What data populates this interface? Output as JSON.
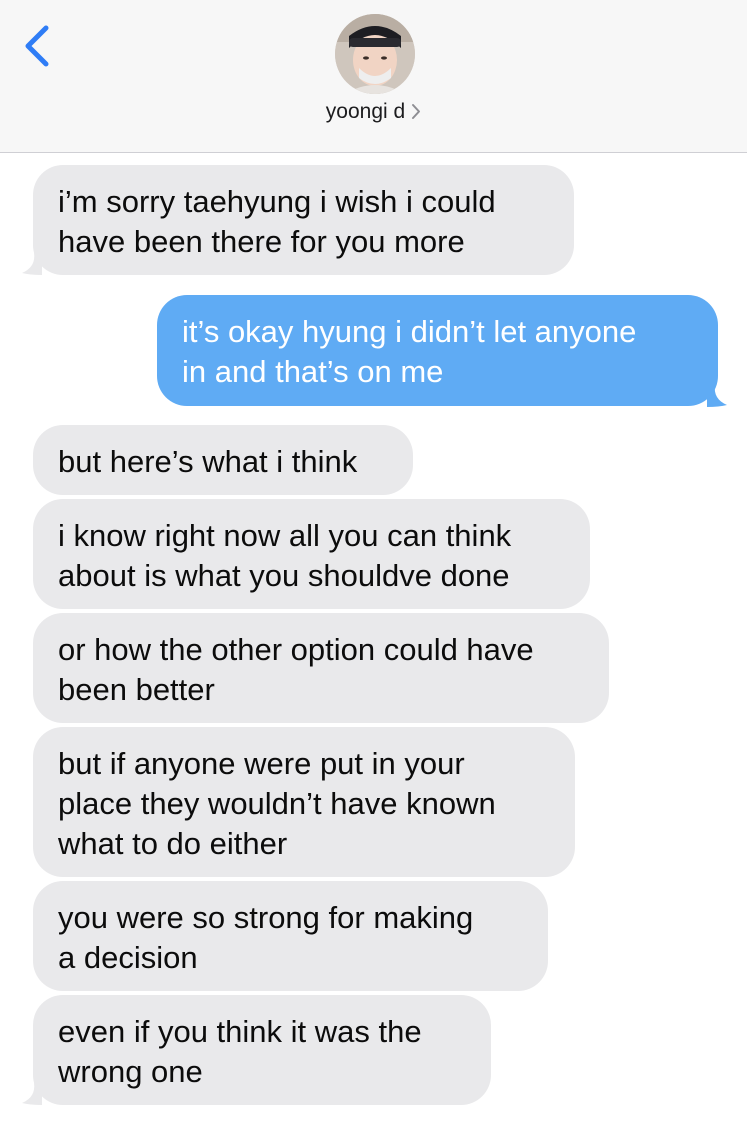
{
  "header": {
    "contact_name": "yoongi d",
    "back_icon": "chevron-left-icon",
    "contact_chevron_icon": "chevron-right-icon",
    "avatar": "contact-avatar-photo"
  },
  "colors": {
    "incoming_bubble": "#e9e9eb",
    "outgoing_bubble": "#5fabf4",
    "accent": "#2f7df6",
    "header_bg": "#f7f7f7"
  },
  "messages": [
    {
      "direction": "incoming",
      "text": "i’m sorry taehyung i wish i could\nhave been there for you more"
    },
    {
      "direction": "outgoing",
      "text": "it’s okay hyung i didn’t let anyone\nin and that’s on me"
    },
    {
      "direction": "incoming",
      "text": "but here’s what i think"
    },
    {
      "direction": "incoming",
      "text": "i know right now all you can think\nabout is what you shouldve done"
    },
    {
      "direction": "incoming",
      "text": "or how the other option could have\nbeen better"
    },
    {
      "direction": "incoming",
      "text": "but if anyone were put in your\nplace they wouldn’t have known\nwhat to do either"
    },
    {
      "direction": "incoming",
      "text": "you were so strong for making\na decision"
    },
    {
      "direction": "incoming",
      "text": "even if you think it was the\nwrong one"
    }
  ]
}
